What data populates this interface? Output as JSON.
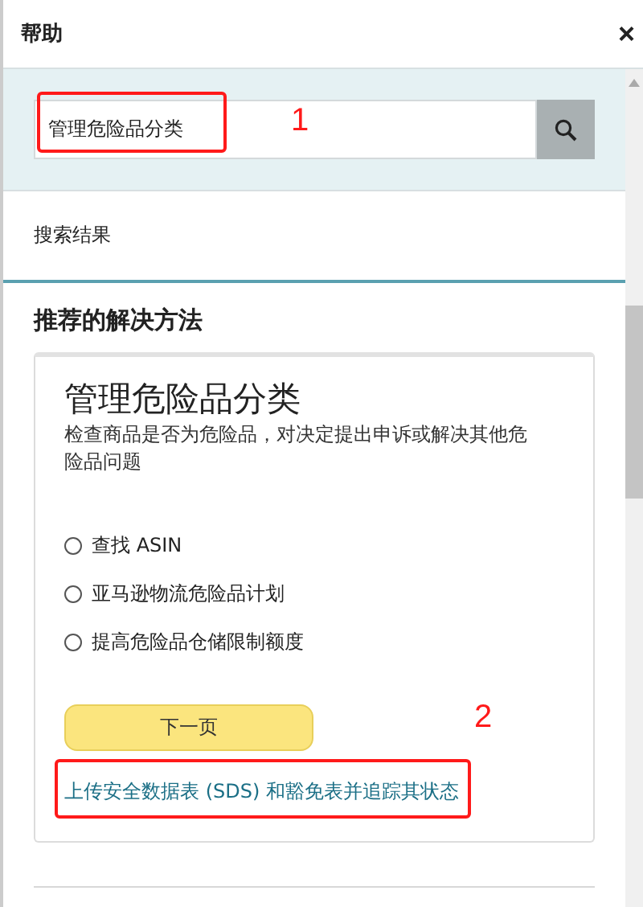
{
  "header": {
    "title": "帮助",
    "close": "×"
  },
  "search": {
    "value": "管理危险品分类"
  },
  "results_label": "搜索结果",
  "section_title": "推荐的解决方法",
  "card": {
    "title": "管理危险品分类",
    "description": "检查商品是否为危险品，对决定提出申诉或解决其他危险品问题",
    "options": [
      {
        "label": "查找 ASIN",
        "selected": false
      },
      {
        "label": "亚马逊物流危险品计划",
        "selected": false
      },
      {
        "label": "提高危险品仓储限制额度",
        "selected": false
      }
    ],
    "button": "下一页",
    "link": "上传安全数据表 (SDS) 和豁免表并追踪其状态"
  },
  "annotations": [
    {
      "label": "1"
    },
    {
      "label": "2"
    }
  ]
}
